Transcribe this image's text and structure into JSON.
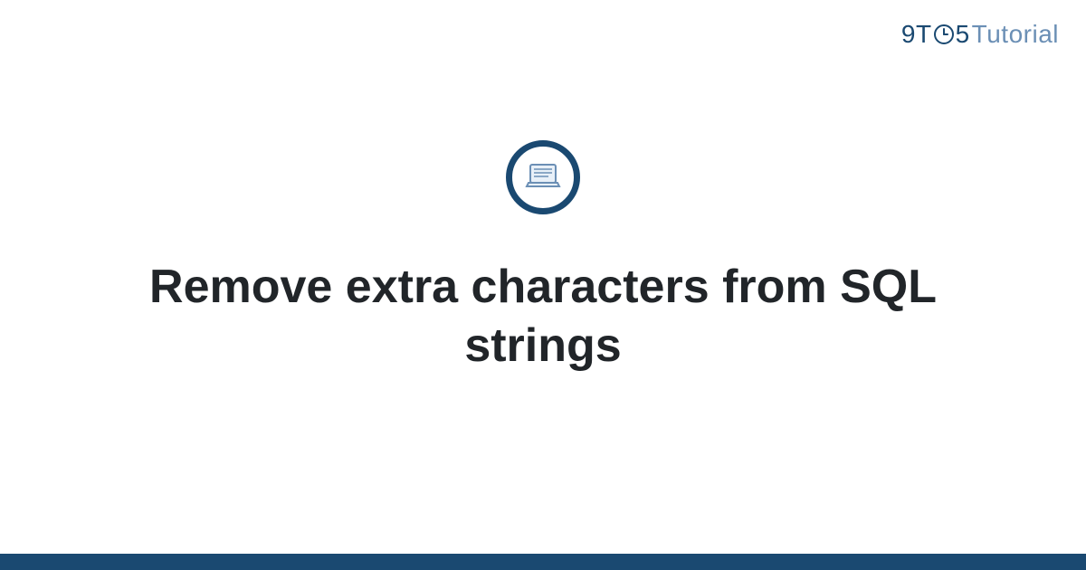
{
  "brand": {
    "part1": "9",
    "part2": "T",
    "part3": "5",
    "part4": "Tutorial"
  },
  "page": {
    "title": "Remove extra characters from SQL strings"
  },
  "colors": {
    "primary": "#1a4971",
    "secondary": "#6b8fb5"
  }
}
